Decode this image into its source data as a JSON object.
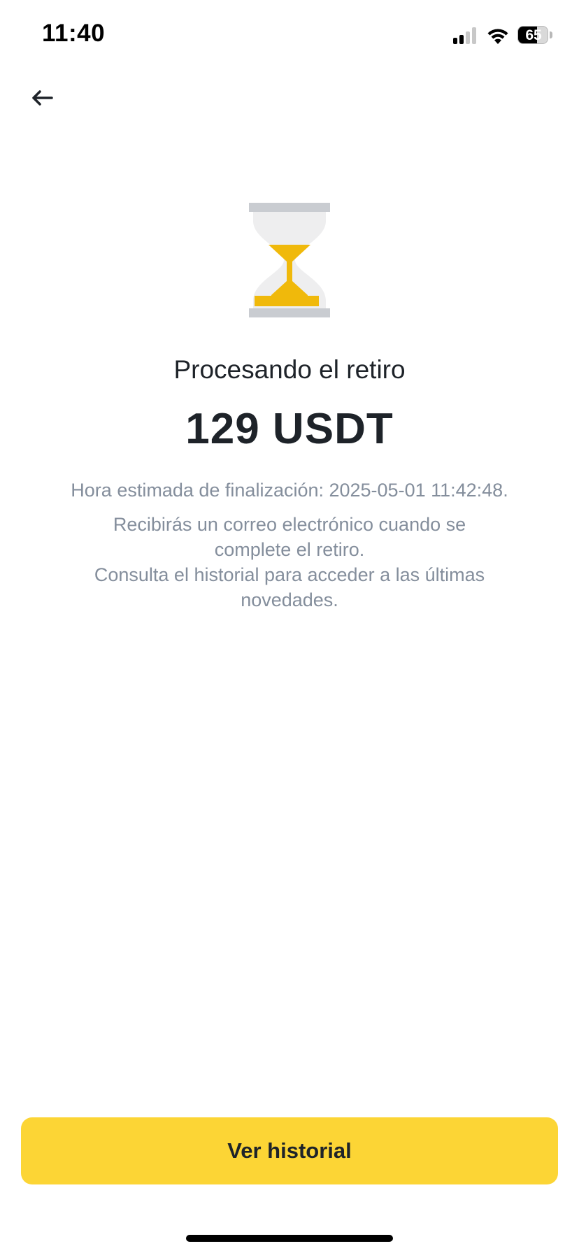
{
  "status_bar": {
    "time": "11:40",
    "battery_level": "65",
    "battery_fraction": 0.65,
    "signal_bars_active": 2,
    "signal_bars_total": 4
  },
  "nav": {
    "back_icon": "arrow-left-icon"
  },
  "hero": {
    "icon": "hourglass-icon",
    "accent_color": "#F0B90B",
    "frame_color": "#C9CCD1"
  },
  "main": {
    "title": "Procesando el retiro",
    "amount": "129 USDT",
    "eta": "Hora estimada de finalización: 2025-05-01 11:42:48.",
    "info_line_1": "Recibirás un correo electrónico cuando se complete el retiro.",
    "info_line_2": "Consulta el historial para acceder a las últimas novedades."
  },
  "actions": {
    "history_label": "Ver historial",
    "button_color": "#FCD535"
  }
}
